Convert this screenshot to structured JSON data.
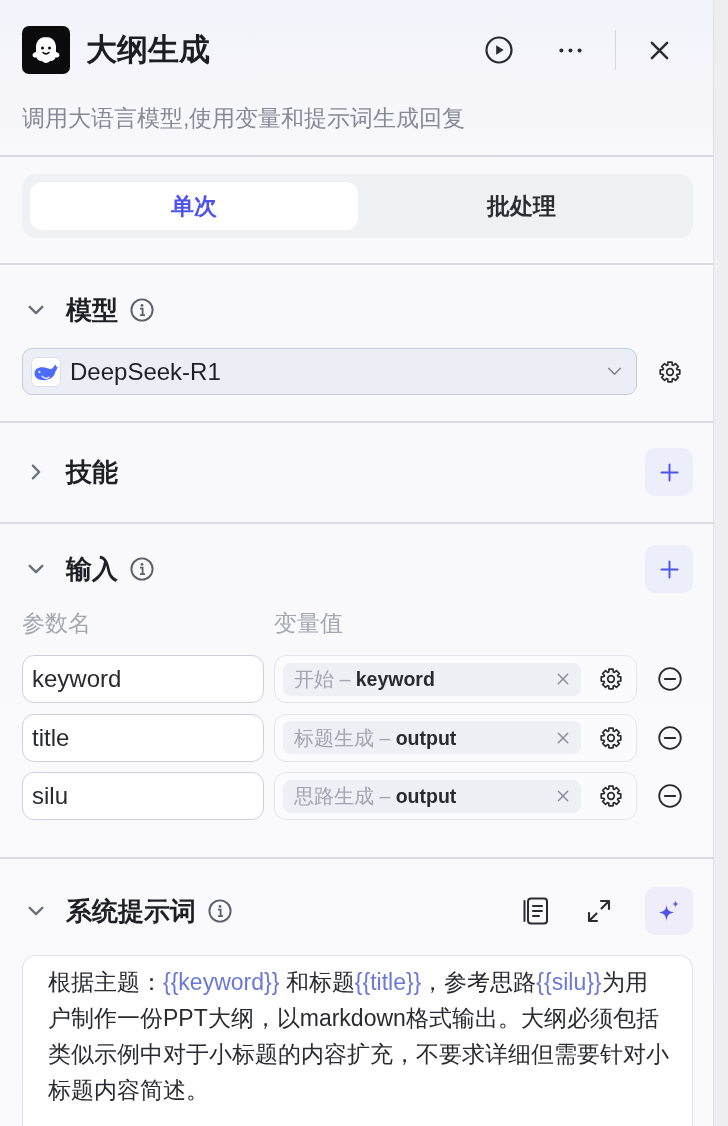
{
  "header": {
    "title": "大纲生成",
    "description": "调用大语言模型,使用变量和提示词生成回复"
  },
  "tabs": [
    {
      "label": "单次",
      "selected": true
    },
    {
      "label": "批处理",
      "selected": false
    }
  ],
  "model_section": {
    "title": "模型",
    "expanded": true,
    "info": true,
    "model": "DeepSeek-R1"
  },
  "skills_section": {
    "title": "技能",
    "expanded": false,
    "info": false
  },
  "input_section": {
    "title": "输入",
    "expanded": true,
    "info": true,
    "columns": [
      "参数名",
      "变量值"
    ],
    "rows": [
      {
        "name": "keyword",
        "value": "开始 – **keyword**"
      },
      {
        "name": "title",
        "value": "标题生成 – **output**"
      },
      {
        "name": "silu",
        "value": "思路生成 – **output**"
      }
    ]
  },
  "prompt_section": {
    "title": "系统提示词",
    "expanded": true,
    "info": true,
    "segments": [
      {
        "kind": "text",
        "text": "根据主题："
      },
      {
        "kind": "variable",
        "text": "{{keyword}}"
      },
      {
        "kind": "text",
        "text": " 和标题"
      },
      {
        "kind": "variable",
        "text": "{{title}}"
      },
      {
        "kind": "text",
        "text": "，参考思路"
      },
      {
        "kind": "variable",
        "text": "{{silu}}"
      },
      {
        "kind": "text",
        "text": "为用户制作一份PPT大纲，以markdown格式输出。大纲必须包括类似示例中对于小标题的内容扩充，不要求详细但需要针对小标题内容简述。"
      }
    ]
  }
}
